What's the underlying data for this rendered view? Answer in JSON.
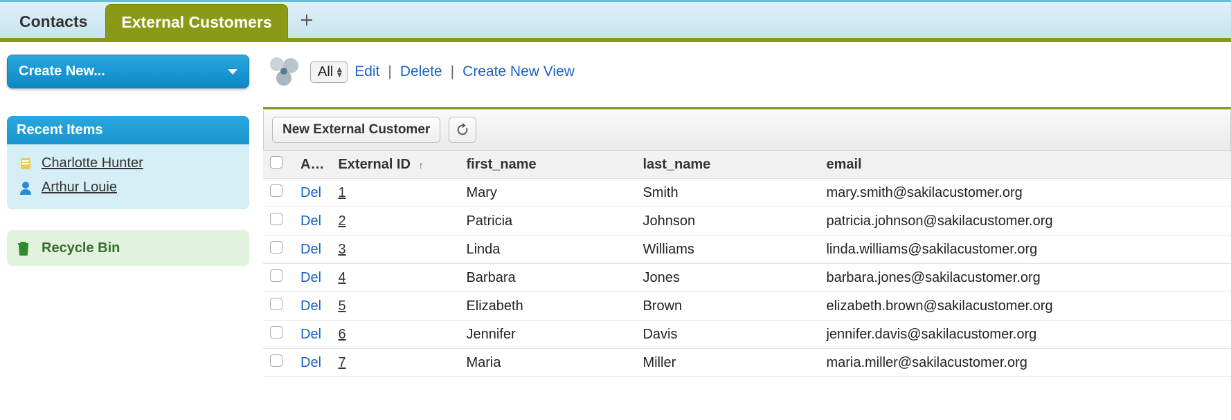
{
  "tabs": {
    "inactive": "Contacts",
    "active": "External Customers"
  },
  "sidebar": {
    "create_new": "Create New...",
    "recent_header": "Recent Items",
    "recent_items": [
      {
        "icon": "card-icon",
        "label": "Charlotte Hunter"
      },
      {
        "icon": "person-icon",
        "label": "Arthur Louie"
      }
    ],
    "recycle": "Recycle Bin"
  },
  "view": {
    "selected": "All",
    "edit": "Edit",
    "delete": "Delete",
    "create_new_view": "Create New View"
  },
  "toolbar": {
    "new_btn": "New External Customer"
  },
  "columns": {
    "action": "A…",
    "external_id": "External ID",
    "first_name": "first_name",
    "last_name": "last_name",
    "email": "email"
  },
  "row_action": "Del",
  "rows": [
    {
      "id": "1",
      "first_name": "Mary",
      "last_name": "Smith",
      "email": "mary.smith@sakilacustomer.org"
    },
    {
      "id": "2",
      "first_name": "Patricia",
      "last_name": "Johnson",
      "email": "patricia.johnson@sakilacustomer.org"
    },
    {
      "id": "3",
      "first_name": "Linda",
      "last_name": "Williams",
      "email": "linda.williams@sakilacustomer.org"
    },
    {
      "id": "4",
      "first_name": "Barbara",
      "last_name": "Jones",
      "email": "barbara.jones@sakilacustomer.org"
    },
    {
      "id": "5",
      "first_name": "Elizabeth",
      "last_name": "Brown",
      "email": "elizabeth.brown@sakilacustomer.org"
    },
    {
      "id": "6",
      "first_name": "Jennifer",
      "last_name": "Davis",
      "email": "jennifer.davis@sakilacustomer.org"
    },
    {
      "id": "7",
      "first_name": "Maria",
      "last_name": "Miller",
      "email": "maria.miller@sakilacustomer.org"
    }
  ]
}
